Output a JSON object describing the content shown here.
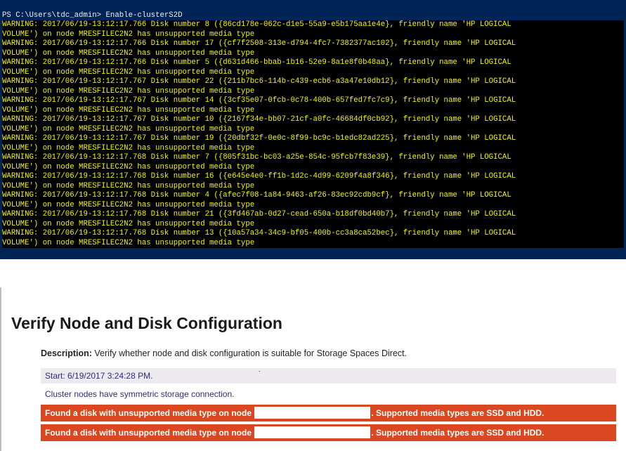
{
  "terminal": {
    "prompt": "PS C:\\Users\\tdc_admin> ",
    "command": "Enable-clusterS2D",
    "node": "MRESFILEC2N2",
    "friendly": "HP LOGICAL",
    "volume": "VOLUME",
    "tail": "has unsupported media type",
    "warnings": [
      {
        "ts": "2017/06/19-13:12:17.766",
        "num": "8",
        "guid": "{86cd178e-062c-d1e5-55a9-e5b175aa1e4e}"
      },
      {
        "ts": "2017/06/19-13:12:17.766",
        "num": "17",
        "guid": "{cf7f2508-313e-d794-4fc7-7382377ac102}"
      },
      {
        "ts": "2017/06/19-13:12:17.766",
        "num": "5",
        "guid": "{d631d466-bbab-1b16-52e9-8a1e8f0b48aa}"
      },
      {
        "ts": "2017/06/19-13:12:17.767",
        "num": "22",
        "guid": "{211b7bc6-114b-c439-ecb6-a3a47e10db12}"
      },
      {
        "ts": "2017/06/19-13:12:17.767",
        "num": "14",
        "guid": "{3cf35e07-0fcb-0c78-400b-657fed7fc7c9}"
      },
      {
        "ts": "2017/06/19-13:12:17.767",
        "num": "10",
        "guid": "{2167f34e-bb07-21cf-a0fc-46684df0cb92}"
      },
      {
        "ts": "2017/06/19-13:12:17.767",
        "num": "19",
        "guid": "{20dbf32f-0e0c-8f99-bc9c-b1edc82ad225}"
      },
      {
        "ts": "2017/06/19-13:12:17.768",
        "num": "7",
        "guid": "{805f31bc-bc03-a25e-854c-95fcb7f83e39}"
      },
      {
        "ts": "2017/06/19-13:12:17.768",
        "num": "16",
        "guid": "{e645e4e0-ff1b-1d2c-4d99-6209f4a8f346}"
      },
      {
        "ts": "2017/06/19-13:12:17.768",
        "num": "4",
        "guid": "{afec7f08-1a84-9463-af26-83ec92cdb9cf}"
      },
      {
        "ts": "2017/06/19-13:12:17.768",
        "num": "21",
        "guid": "{3fd467ab-0d27-cead-650a-b18df0bd40b7}"
      },
      {
        "ts": "2017/06/19-13:12:17.768",
        "num": "13",
        "guid": "{10a57a34-34c9-bf05-400b-cc3a8ca52bec}"
      }
    ]
  },
  "report": {
    "title": "Verify Node and Disk Configuration",
    "description_label": "Description:",
    "description_text": " Verify whether node and disk configuration is suitable for Storage Spaces Direct.",
    "start": "Start: 6/19/2017 3:24:28 PM.",
    "symmetric": "Cluster nodes have symmetric storage connection.",
    "error_prefix": "Found a disk with unsupported media type on node ",
    "error_suffix": ". Supported media types are SSD and HDD.",
    "errors": [
      1,
      2
    ]
  }
}
